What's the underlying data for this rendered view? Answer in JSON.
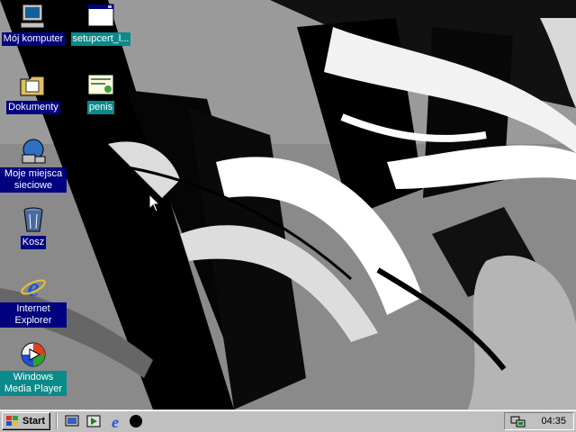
{
  "desktop": {
    "icons": [
      {
        "label": "Mój komputer",
        "icon": "my-computer-icon"
      },
      {
        "label": "setupcert_l...",
        "icon": "window-file-icon"
      },
      {
        "label": "Dokumenty",
        "icon": "folder-documents-icon"
      },
      {
        "label": "penis",
        "icon": "certificate-file-icon"
      },
      {
        "label": "Moje miejsca sieciowe",
        "icon": "network-places-icon"
      },
      {
        "label": "Kosz",
        "icon": "recycle-bin-icon"
      },
      {
        "label": "Internet Explorer",
        "icon": "internet-explorer-icon"
      },
      {
        "label": "Windows Media Player",
        "icon": "media-player-icon"
      }
    ]
  },
  "taskbar": {
    "start_label": "Start",
    "quick_launch": [
      "show-desktop-icon",
      "media-icon",
      "internet-explorer-icon",
      "black-circle-icon"
    ],
    "clock": "04:35"
  },
  "colors": {
    "selection": "#000080",
    "teal_label": "#0a8a8a",
    "taskbar": "#c0c0c0"
  }
}
